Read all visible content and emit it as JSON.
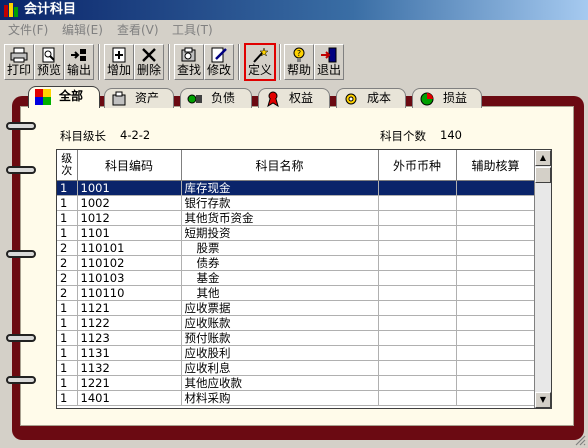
{
  "window": {
    "title": "会计科目"
  },
  "menu": [
    {
      "label": "文件(F)"
    },
    {
      "label": "编辑(E)"
    },
    {
      "label": "查看(V)"
    },
    {
      "label": "工具(T)"
    }
  ],
  "toolbar": [
    {
      "label": "打印",
      "icon": "printer-icon"
    },
    {
      "label": "预览",
      "icon": "preview-icon"
    },
    {
      "label": "输出",
      "icon": "export-icon"
    },
    {
      "label": "增加",
      "icon": "add-icon"
    },
    {
      "label": "删除",
      "icon": "delete-icon"
    },
    {
      "label": "查找",
      "icon": "find-icon"
    },
    {
      "label": "修改",
      "icon": "edit-icon"
    },
    {
      "label": "定义",
      "icon": "wand-icon",
      "highlighted": true
    },
    {
      "label": "帮助",
      "icon": "help-icon"
    },
    {
      "label": "退出",
      "icon": "exit-icon"
    }
  ],
  "tabs": [
    {
      "label": "全部",
      "active": true,
      "icon": "all-icon"
    },
    {
      "label": "资产",
      "icon": "asset-icon"
    },
    {
      "label": "负债",
      "icon": "liability-icon"
    },
    {
      "label": "权益",
      "icon": "equity-icon"
    },
    {
      "label": "成本",
      "icon": "cost-icon"
    },
    {
      "label": "损益",
      "icon": "profit-loss-icon"
    }
  ],
  "info": {
    "level_label": "科目级长",
    "level_value": "4-2-2",
    "count_label": "科目个数",
    "count_value": "140"
  },
  "table": {
    "columns": [
      "级次",
      "科目编码",
      "科目名称",
      "外币币种",
      "辅助核算"
    ],
    "rows": [
      {
        "level": "1",
        "code": "1001",
        "name": "库存现金",
        "currency": "",
        "aux": "",
        "selected": true
      },
      {
        "level": "1",
        "code": "1002",
        "name": "银行存款",
        "currency": "",
        "aux": ""
      },
      {
        "level": "1",
        "code": "1012",
        "name": "其他货币资金",
        "currency": "",
        "aux": ""
      },
      {
        "level": "1",
        "code": "1101",
        "name": "短期投资",
        "currency": "",
        "aux": ""
      },
      {
        "level": "2",
        "code": "110101",
        "name": "股票",
        "currency": "",
        "aux": ""
      },
      {
        "level": "2",
        "code": "110102",
        "name": "债券",
        "currency": "",
        "aux": ""
      },
      {
        "level": "2",
        "code": "110103",
        "name": "基金",
        "currency": "",
        "aux": ""
      },
      {
        "level": "2",
        "code": "110110",
        "name": "其他",
        "currency": "",
        "aux": ""
      },
      {
        "level": "1",
        "code": "1121",
        "name": "应收票据",
        "currency": "",
        "aux": ""
      },
      {
        "level": "1",
        "code": "1122",
        "name": "应收账款",
        "currency": "",
        "aux": ""
      },
      {
        "level": "1",
        "code": "1123",
        "name": "预付账款",
        "currency": "",
        "aux": ""
      },
      {
        "level": "1",
        "code": "1131",
        "name": "应收股利",
        "currency": "",
        "aux": ""
      },
      {
        "level": "1",
        "code": "1132",
        "name": "应收利息",
        "currency": "",
        "aux": ""
      },
      {
        "level": "1",
        "code": "1221",
        "name": "其他应收款",
        "currency": "",
        "aux": ""
      },
      {
        "level": "1",
        "code": "1401",
        "name": "材料采购",
        "currency": "",
        "aux": ""
      }
    ]
  },
  "colors": {
    "selection": "#0a246a",
    "binder": "#6b0a12",
    "page": "#fffbea",
    "highlight": "#e00000"
  }
}
